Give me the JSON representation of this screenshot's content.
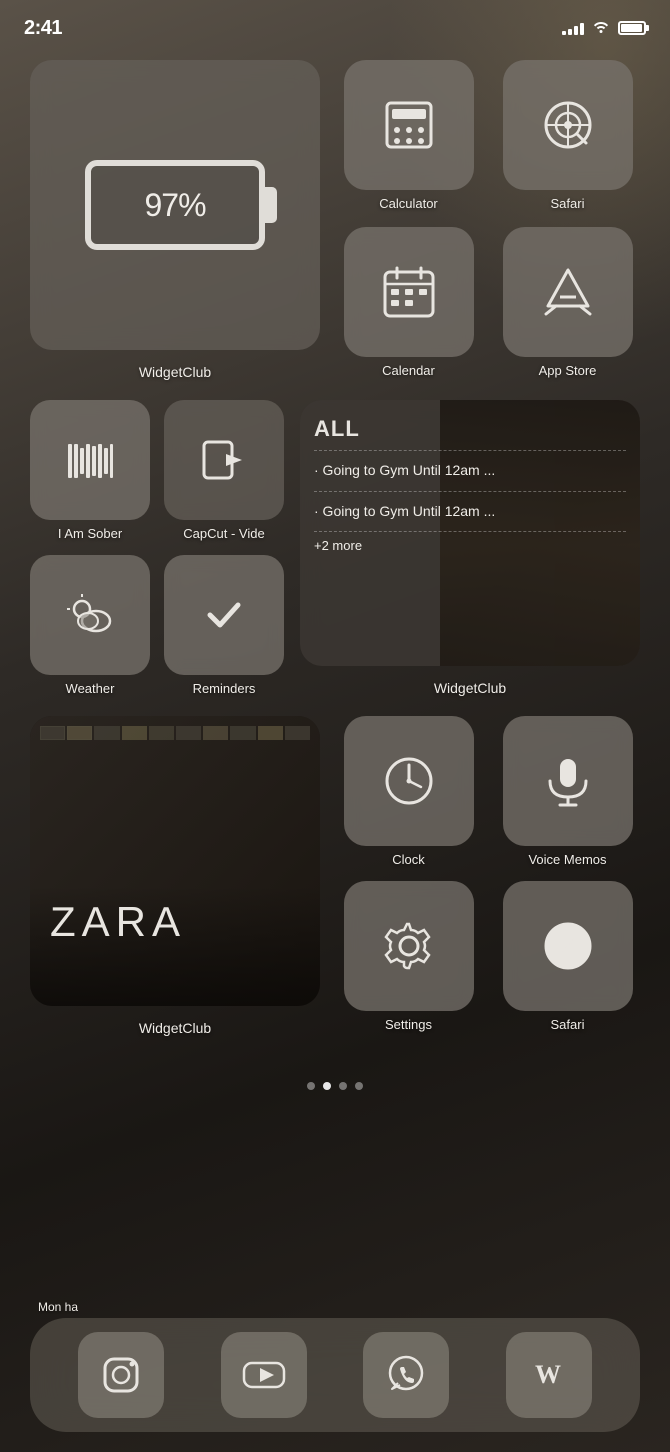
{
  "statusBar": {
    "time": "2:41",
    "signalBars": [
      4,
      6,
      8,
      11,
      14
    ],
    "battery": "97%"
  },
  "widgets": {
    "batteryWidget": {
      "percentage": "97%",
      "label": "WidgetClub"
    },
    "calendarWidget": {
      "title": "ALL",
      "events": [
        "· Going to Gym Until 12am ...",
        "· Going to Gym Until 12am ..."
      ],
      "more": "+2 more",
      "label": "WidgetClub"
    },
    "zaraWidget": {
      "text": "ZARA",
      "label": "WidgetClub"
    }
  },
  "apps": {
    "calculator": {
      "name": "Calculator"
    },
    "safari1": {
      "name": "Safari"
    },
    "calendar": {
      "name": "Calendar"
    },
    "appstore": {
      "name": "App Store"
    },
    "iamsober": {
      "name": "I Am Sober"
    },
    "capcut": {
      "name": "CapCut - Vide"
    },
    "weather": {
      "name": "Weather"
    },
    "reminders": {
      "name": "Reminders"
    },
    "clock": {
      "name": "Clock"
    },
    "voicememos": {
      "name": "Voice Memos"
    },
    "settings": {
      "name": "Settings"
    },
    "safari2": {
      "name": "Safari"
    }
  },
  "dock": {
    "partialLabel": "Mon ha",
    "apps": [
      {
        "name": "Instagram",
        "id": "instagram"
      },
      {
        "name": "YouTube",
        "id": "youtube"
      },
      {
        "name": "WhatsApp",
        "id": "whatsapp"
      },
      {
        "name": "Wattpad",
        "id": "wattpad"
      }
    ]
  },
  "pageDots": {
    "current": 1,
    "total": 4
  }
}
